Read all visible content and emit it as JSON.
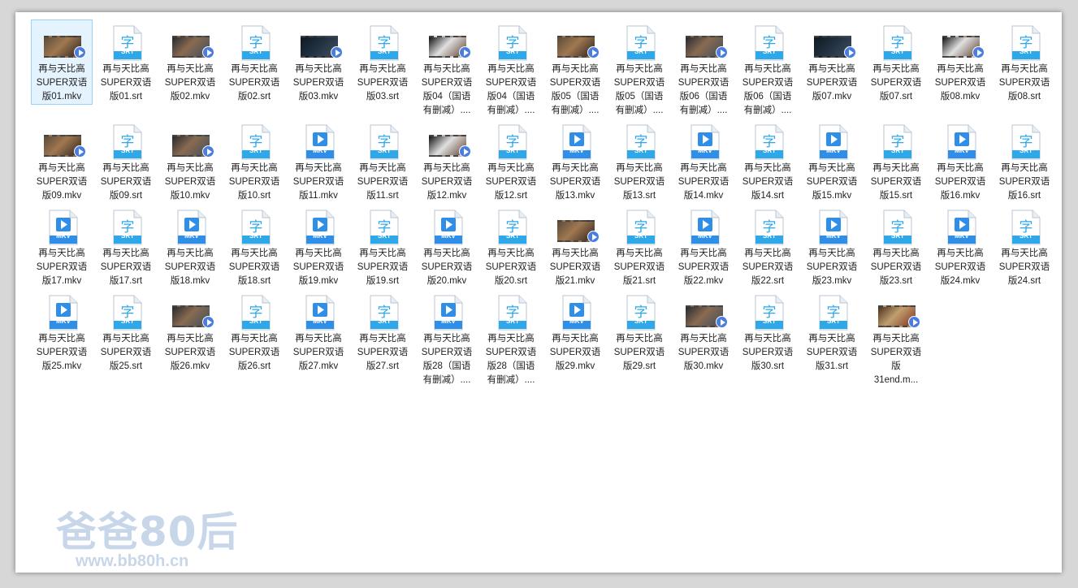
{
  "colors": {
    "srt_icon": "#2fa8ea",
    "mkv_icon": "#2f8ee8",
    "selection_border": "#99d1ff",
    "selection_fill": "#e5f3ff",
    "watermark": "#c8d6ea"
  },
  "watermark": {
    "title": "爸爸80后",
    "url": "www.bb80h.cn"
  },
  "files": [
    {
      "name": "再与天比高\nSUPER双语\n版01.mkv",
      "type": "video",
      "selected": true
    },
    {
      "name": "再与天比高\nSUPER双语\n版01.srt",
      "type": "srt"
    },
    {
      "name": "再与天比高\nSUPER双语\n版02.mkv",
      "type": "video"
    },
    {
      "name": "再与天比高\nSUPER双语\n版02.srt",
      "type": "srt"
    },
    {
      "name": "再与天比高\nSUPER双语\n版03.mkv",
      "type": "video"
    },
    {
      "name": "再与天比高\nSUPER双语\n版03.srt",
      "type": "srt"
    },
    {
      "name": "再与天比高\nSUPER双语\n版04（国语\n有删减）....",
      "type": "video"
    },
    {
      "name": "再与天比高\nSUPER双语\n版04（国语\n有删减）....",
      "type": "srt"
    },
    {
      "name": "再与天比高\nSUPER双语\n版05（国语\n有删减）....",
      "type": "video"
    },
    {
      "name": "再与天比高\nSUPER双语\n版05（国语\n有删减）....",
      "type": "srt"
    },
    {
      "name": "再与天比高\nSUPER双语\n版06（国语\n有删减）....",
      "type": "video"
    },
    {
      "name": "再与天比高\nSUPER双语\n版06（国语\n有删减）....",
      "type": "srt"
    },
    {
      "name": "再与天比高\nSUPER双语\n版07.mkv",
      "type": "video"
    },
    {
      "name": "再与天比高\nSUPER双语\n版07.srt",
      "type": "srt"
    },
    {
      "name": "再与天比高\nSUPER双语\n版08.mkv",
      "type": "video"
    },
    {
      "name": "再与天比高\nSUPER双语\n版08.srt",
      "type": "srt"
    },
    {
      "name": "再与天比高\nSUPER双语\n版09.mkv",
      "type": "video"
    },
    {
      "name": "再与天比高\nSUPER双语\n版09.srt",
      "type": "srt"
    },
    {
      "name": "再与天比高\nSUPER双语\n版10.mkv",
      "type": "video"
    },
    {
      "name": "再与天比高\nSUPER双语\n版10.srt",
      "type": "srt"
    },
    {
      "name": "再与天比高\nSUPER双语\n版11.mkv",
      "type": "mkv"
    },
    {
      "name": "再与天比高\nSUPER双语\n版11.srt",
      "type": "srt"
    },
    {
      "name": "再与天比高\nSUPER双语\n版12.mkv",
      "type": "video"
    },
    {
      "name": "再与天比高\nSUPER双语\n版12.srt",
      "type": "srt"
    },
    {
      "name": "再与天比高\nSUPER双语\n版13.mkv",
      "type": "mkv"
    },
    {
      "name": "再与天比高\nSUPER双语\n版13.srt",
      "type": "srt"
    },
    {
      "name": "再与天比高\nSUPER双语\n版14.mkv",
      "type": "mkv"
    },
    {
      "name": "再与天比高\nSUPER双语\n版14.srt",
      "type": "srt"
    },
    {
      "name": "再与天比高\nSUPER双语\n版15.mkv",
      "type": "mkv"
    },
    {
      "name": "再与天比高\nSUPER双语\n版15.srt",
      "type": "srt"
    },
    {
      "name": "再与天比高\nSUPER双语\n版16.mkv",
      "type": "mkv"
    },
    {
      "name": "再与天比高\nSUPER双语\n版16.srt",
      "type": "srt"
    },
    {
      "name": "再与天比高\nSUPER双语\n版17.mkv",
      "type": "mkv"
    },
    {
      "name": "再与天比高\nSUPER双语\n版17.srt",
      "type": "srt"
    },
    {
      "name": "再与天比高\nSUPER双语\n版18.mkv",
      "type": "mkv"
    },
    {
      "name": "再与天比高\nSUPER双语\n版18.srt",
      "type": "srt"
    },
    {
      "name": "再与天比高\nSUPER双语\n版19.mkv",
      "type": "mkv"
    },
    {
      "name": "再与天比高\nSUPER双语\n版19.srt",
      "type": "srt"
    },
    {
      "name": "再与天比高\nSUPER双语\n版20.mkv",
      "type": "mkv"
    },
    {
      "name": "再与天比高\nSUPER双语\n版20.srt",
      "type": "srt"
    },
    {
      "name": "再与天比高\nSUPER双语\n版21.mkv",
      "type": "video"
    },
    {
      "name": "再与天比高\nSUPER双语\n版21.srt",
      "type": "srt"
    },
    {
      "name": "再与天比高\nSUPER双语\n版22.mkv",
      "type": "mkv"
    },
    {
      "name": "再与天比高\nSUPER双语\n版22.srt",
      "type": "srt"
    },
    {
      "name": "再与天比高\nSUPER双语\n版23.mkv",
      "type": "mkv"
    },
    {
      "name": "再与天比高\nSUPER双语\n版23.srt",
      "type": "srt"
    },
    {
      "name": "再与天比高\nSUPER双语\n版24.mkv",
      "type": "mkv"
    },
    {
      "name": "再与天比高\nSUPER双语\n版24.srt",
      "type": "srt"
    },
    {
      "name": "再与天比高\nSUPER双语\n版25.mkv",
      "type": "mkv"
    },
    {
      "name": "再与天比高\nSUPER双语\n版25.srt",
      "type": "srt"
    },
    {
      "name": "再与天比高\nSUPER双语\n版26.mkv",
      "type": "video"
    },
    {
      "name": "再与天比高\nSUPER双语\n版26.srt",
      "type": "srt"
    },
    {
      "name": "再与天比高\nSUPER双语\n版27.mkv",
      "type": "mkv"
    },
    {
      "name": "再与天比高\nSUPER双语\n版27.srt",
      "type": "srt"
    },
    {
      "name": "再与天比高\nSUPER双语\n版28（国语\n有删减）....",
      "type": "mkv"
    },
    {
      "name": "再与天比高\nSUPER双语\n版28（国语\n有删减）....",
      "type": "srt"
    },
    {
      "name": "再与天比高\nSUPER双语\n版29.mkv",
      "type": "mkv"
    },
    {
      "name": "再与天比高\nSUPER双语\n版29.srt",
      "type": "srt"
    },
    {
      "name": "再与天比高\nSUPER双语\n版30.mkv",
      "type": "video"
    },
    {
      "name": "再与天比高\nSUPER双语\n版30.srt",
      "type": "srt"
    },
    {
      "name": "再与天比高\nSUPER双语\n版31.srt",
      "type": "srt"
    },
    {
      "name": "再与天比高\nSUPER双语\n版\n31end.m...",
      "type": "video"
    }
  ],
  "icon_text": {
    "srt_glyph": "字",
    "srt_tag": "SRT",
    "mkv_tag": "MKV"
  }
}
